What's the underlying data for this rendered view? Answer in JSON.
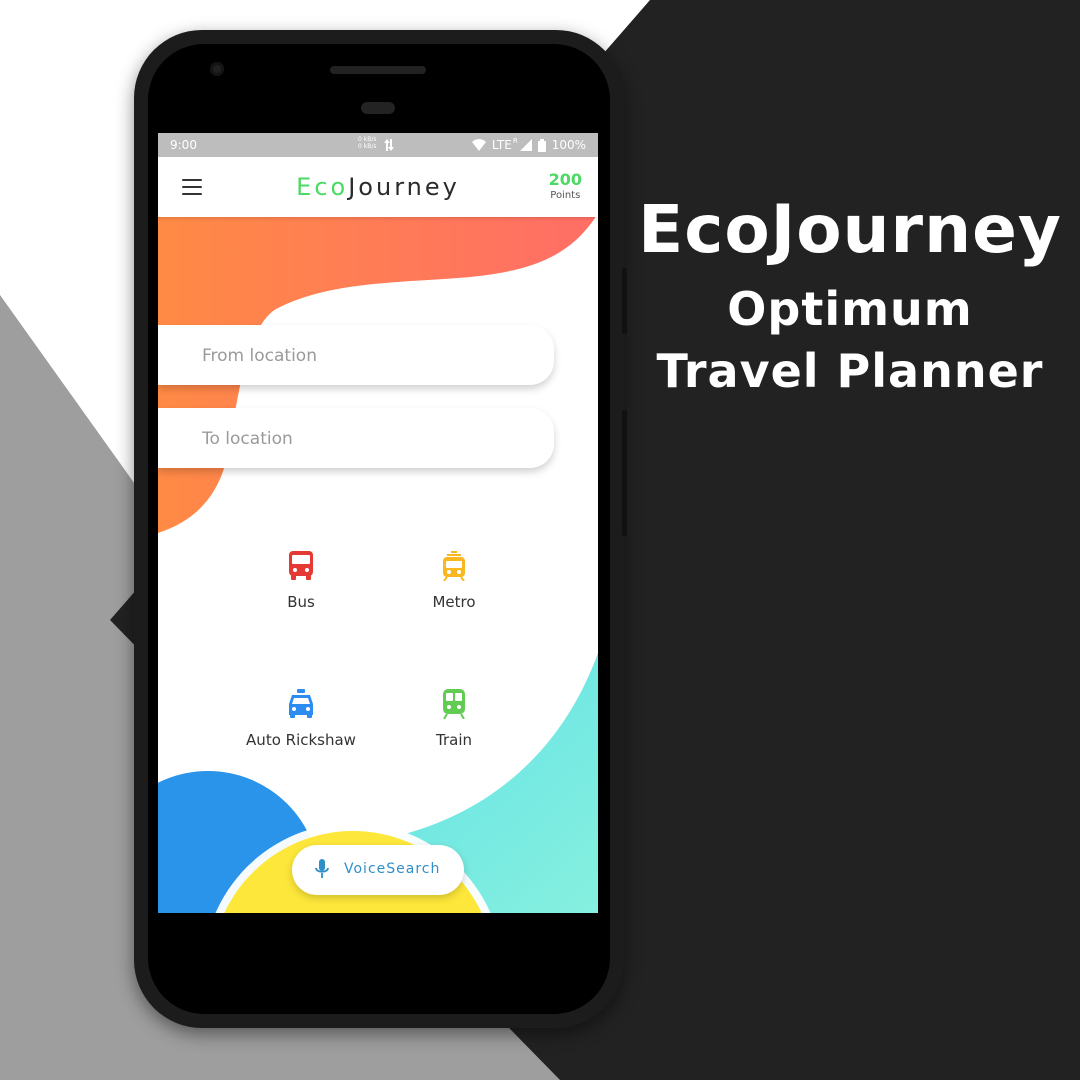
{
  "promo": {
    "title": "EcoJourney",
    "subtitle_line1": "Optimum",
    "subtitle_line2": "Travel Planner"
  },
  "statusbar": {
    "time": "9:00",
    "net_up": "0 kB/s",
    "net_down": "0 kB/s",
    "network": "LTE",
    "roaming": "R",
    "battery": "100%"
  },
  "appbar": {
    "logo_eco": "Eco",
    "logo_journey": "Journey",
    "points_value": "200",
    "points_label": "Points"
  },
  "search": {
    "from_placeholder": "From location",
    "to_placeholder": "To location"
  },
  "modes": [
    {
      "label": "Bus",
      "icon": "bus-icon",
      "color": "#e53935"
    },
    {
      "label": "Metro",
      "icon": "tram-icon",
      "color": "#f9b820"
    },
    {
      "label": "Auto Rickshaw",
      "icon": "taxi-icon",
      "color": "#2d8cf0"
    },
    {
      "label": "Train",
      "icon": "train-icon",
      "color": "#62cc52"
    }
  ],
  "voice": {
    "label": "VoiceSearch"
  },
  "colors": {
    "accent_green": "#4cd964",
    "blob_orange": "#ff7a5c",
    "blob_teal": "#6ce5e2",
    "blob_blue": "#2a93ea",
    "blob_yellow": "#fde73a",
    "dark_bg": "#222222",
    "grey_bg": "#9e9e9e"
  }
}
